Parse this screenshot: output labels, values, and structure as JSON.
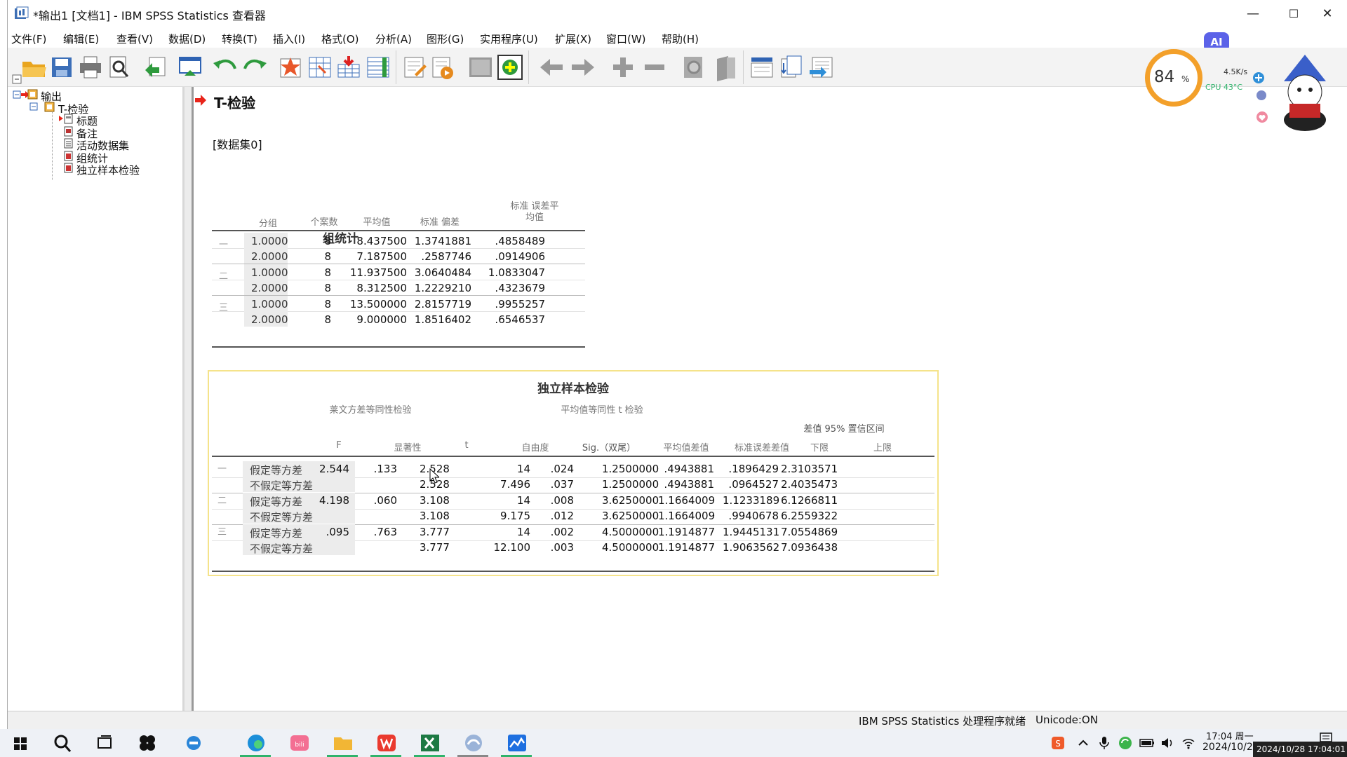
{
  "window": {
    "title": "*输出1 [文档1] - IBM SPSS Statistics 查看器",
    "minimize": "—",
    "maximize": "☐",
    "close": "✕"
  },
  "menu": [
    "文件(F)",
    "编辑(E)",
    "查看(V)",
    "数据(D)",
    "转换(T)",
    "插入(I)",
    "格式(O)",
    "分析(A)",
    "图形(G)",
    "实用程序(U)",
    "扩展(X)",
    "窗口(W)",
    "帮助(H)"
  ],
  "ai_badge": "AI",
  "widget": {
    "percent": "84",
    "percent_unit": "%",
    "net": "4.5K/s",
    "cpu": "CPU 43°C"
  },
  "tree": {
    "root": "输出",
    "section": "T-检验",
    "items": [
      "标题",
      "备注",
      "活动数据集",
      "组统计",
      "独立样本检验"
    ]
  },
  "content": {
    "heading": "T-检验",
    "dataset": "[数据集0]"
  },
  "group_stats": {
    "title": "组统计",
    "headers": [
      "分组",
      "个案数",
      "平均值",
      "标准 偏差",
      "标准 误差平均值"
    ],
    "rows": [
      {
        "group": "一",
        "cat": "1.0000",
        "n": "8",
        "mean": "8.437500",
        "sd": "1.3741881",
        "se": ".4858489"
      },
      {
        "group": "",
        "cat": "2.0000",
        "n": "8",
        "mean": "7.187500",
        ".sd": "",
        "sd": ".2587746",
        "se": ".0914906"
      },
      {
        "group": "二",
        "cat": "1.0000",
        "n": "8",
        "mean": "11.937500",
        "sd": "3.0640484",
        "se": "1.0833047"
      },
      {
        "group": "",
        "cat": "2.0000",
        "n": "8",
        "mean": "8.312500",
        "sd": "1.2229210",
        "se": ".4323679"
      },
      {
        "group": "三",
        "cat": "1.0000",
        "n": "8",
        "mean": "13.500000",
        "sd": "2.8157719",
        "se": ".9955257"
      },
      {
        "group": "",
        "cat": "2.0000",
        "n": "8",
        "mean": "9.000000",
        "sd": "1.8516402",
        "se": ".6546537"
      }
    ]
  },
  "ind_test": {
    "title": "独立样本检验",
    "levene_header": "莱文方差等同性检验",
    "ttest_header": "平均值等同性 t 检验",
    "ci_header": "差值 95% 置信区间",
    "headers": [
      "F",
      "显著性",
      "t",
      "自由度",
      "Sig.（双尾）",
      "平均值差值",
      "标准误差差值",
      "下限",
      "上限"
    ],
    "rows": [
      {
        "group": "一",
        "label": "假定等方差",
        "F": "2.544",
        "sig": ".133",
        "t": "2.528",
        "df": "14",
        "p": ".024",
        "md": "1.2500000",
        "se": ".4943881",
        "lo": ".1896429",
        "hi": "2.3103571"
      },
      {
        "group": "",
        "label": "不假定等方差",
        "F": "",
        "sig": "",
        "t": "2.528",
        "df": "7.496",
        "p": ".037",
        "md": "1.2500000",
        "se": ".4943881",
        "lo": ".0964527",
        "hi": "2.4035473"
      },
      {
        "group": "二",
        "label": "假定等方差",
        "F": "4.198",
        "sig": ".060",
        "t": "3.108",
        "df": "14",
        "p": ".008",
        "md": "3.6250000",
        "se": "1.1664009",
        "lo": "1.1233189",
        "hi": "6.1266811"
      },
      {
        "group": "",
        "label": "不假定等方差",
        "F": "",
        "sig": "",
        "t": "3.108",
        "df": "9.175",
        "p": ".012",
        "md": "3.6250000",
        "se": "1.1664009",
        "lo": ".9940678",
        "hi": "6.2559322"
      },
      {
        "group": "三",
        "label": "假定等方差",
        "F": ".095",
        "sig": ".763",
        "t": "3.777",
        "df": "14",
        "p": ".002",
        "md": "4.5000000",
        "se": "1.1914877",
        "lo": "1.9445131",
        "hi": "7.0554869"
      },
      {
        "group": "",
        "label": "不假定等方差",
        "F": "",
        "sig": "",
        "t": "3.777",
        "df": "12.100",
        "p": ".003",
        "md": "4.5000000",
        "se": "1.1914877",
        "lo": "1.9063562",
        "hi": "7.0936438"
      }
    ]
  },
  "status": {
    "processor": "IBM SPSS Statistics 处理程序就绪",
    "unicode": "Unicode:ON"
  },
  "taskbar": {
    "time": "17:04 周一",
    "date": "2024/10/2",
    "stamp": "2024/10/28 17:04:01"
  },
  "colors": {
    "accent": "#e8241a",
    "window_bg": "#f0f0f0",
    "taskbar_bg": "#eef1f6",
    "highlight_border": "#f5e38a"
  }
}
